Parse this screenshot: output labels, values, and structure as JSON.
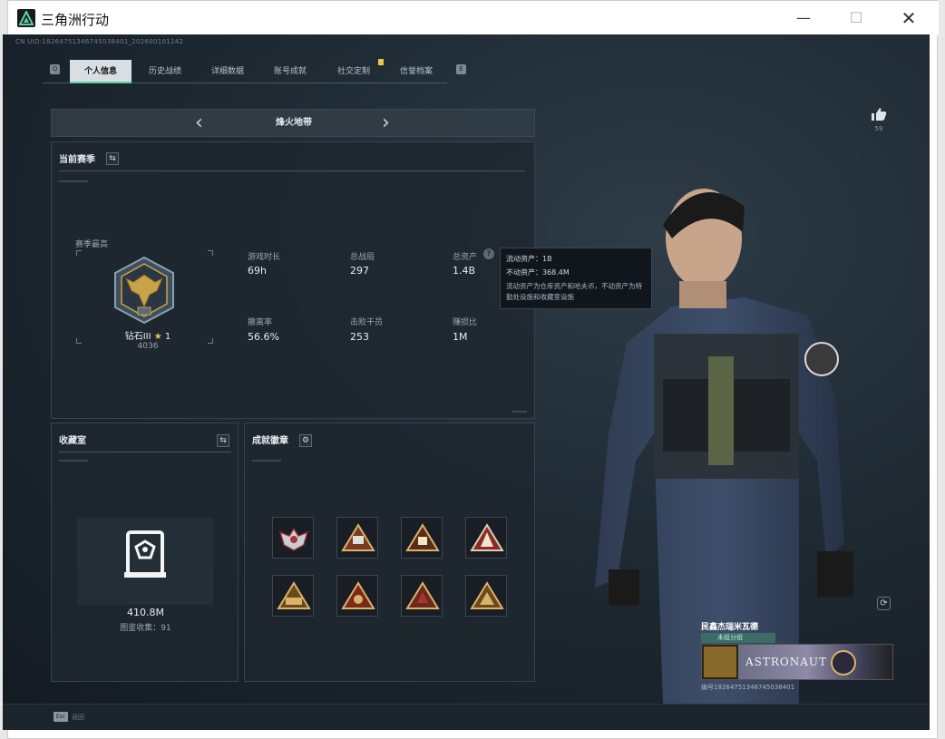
{
  "window": {
    "title": "三角洲行动",
    "minimize": "—",
    "maximize": "☐",
    "close": "✕"
  },
  "game": {
    "uid_top": "CN UID:1826475134674503840​1_2026001011​42"
  },
  "tabs": [
    {
      "label": "个人信息",
      "active": true
    },
    {
      "label": "历史战绩",
      "active": false
    },
    {
      "label": "详细数据",
      "active": false
    },
    {
      "label": "账号成就",
      "active": false
    },
    {
      "label": "社交定制",
      "active": false
    },
    {
      "label": "信誉档案",
      "active": false
    }
  ],
  "mode": {
    "title": "烽火地带",
    "prev": "‹",
    "next": "›"
  },
  "season": {
    "header": "当前赛季",
    "best_label": "赛季最高",
    "rank_name": "钻石III",
    "rank_star_icon": "★",
    "rank_stars": "1",
    "rank_score": "4036",
    "stats": [
      {
        "label": "游戏时长",
        "value": "69h"
      },
      {
        "label": "总战局",
        "value": "297"
      },
      {
        "label": "总资产",
        "value": "1.4B"
      },
      {
        "label": "撤离率",
        "value": "56.6%"
      },
      {
        "label": "击败干员",
        "value": "253"
      },
      {
        "label": "赚损比",
        "value": "1M"
      }
    ]
  },
  "tooltip": {
    "liquid": "流动资产：1B",
    "fixed": "不动资产：368.4M",
    "desc": "流动资产为仓库资产和哈夫币，不动资产为特勤处设施和收藏室设施"
  },
  "collection": {
    "header": "收藏室",
    "value": "410.8M",
    "count_label": "图鉴收集：91"
  },
  "badges": {
    "header": "成就徽章"
  },
  "profile": {
    "like_count": "59",
    "player_name": "民鑫杰瑞米瓦德",
    "team_label": "未组分组",
    "banner_text": "ASTRONAUT",
    "uid": "编号182647513467450384​01"
  },
  "footer": {
    "esc_key": "Esc",
    "esc_label": "返回"
  },
  "colors": {
    "accent": "#5cd0a5",
    "gold": "#c9a24a",
    "bg": "#1f2a33"
  }
}
